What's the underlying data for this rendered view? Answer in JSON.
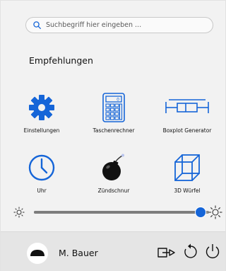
{
  "search": {
    "placeholder": "Suchbegriff hier eingeben ..."
  },
  "recommendations": {
    "title": "Empfehlungen",
    "items": [
      {
        "label": "Einstellungen",
        "icon": "gear-icon"
      },
      {
        "label": "Taschenrechner",
        "icon": "calculator-icon"
      },
      {
        "label": "Boxplot Generator",
        "icon": "boxplot-icon"
      },
      {
        "label": "Uhr",
        "icon": "clock-icon"
      },
      {
        "label": "Zündschnur",
        "icon": "bomb-icon"
      },
      {
        "label": "3D Würfel",
        "icon": "cube-icon"
      }
    ]
  },
  "brightness": {
    "level": 0.95
  },
  "user": {
    "name": "M. Bauer"
  },
  "colors": {
    "accent": "#1565d8",
    "panel": "#f2f2f2",
    "footer": "#e5e5e5"
  }
}
